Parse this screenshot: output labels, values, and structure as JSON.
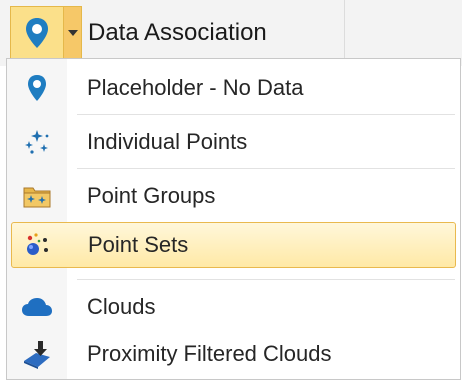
{
  "toolbar": {
    "data_association_label": "Data Association",
    "active_icon": "location-pin-icon"
  },
  "menu": {
    "items": [
      {
        "label": "Placeholder - No Data",
        "icon": "location-pin-icon"
      },
      {
        "label": "Individual Points",
        "icon": "individual-points-icon"
      },
      {
        "label": "Point Groups",
        "icon": "point-groups-icon"
      },
      {
        "label": "Point Sets",
        "icon": "point-sets-icon",
        "highlighted": true
      },
      {
        "label": "Clouds",
        "icon": "cloud-icon"
      },
      {
        "label": "Proximity Filtered Clouds",
        "icon": "proximity-filtered-clouds-icon"
      }
    ]
  },
  "colors": {
    "pin_blue": "#1f7dc1",
    "highlight_fill": "#ffe9a6",
    "highlight_border": "#e9b94e"
  }
}
